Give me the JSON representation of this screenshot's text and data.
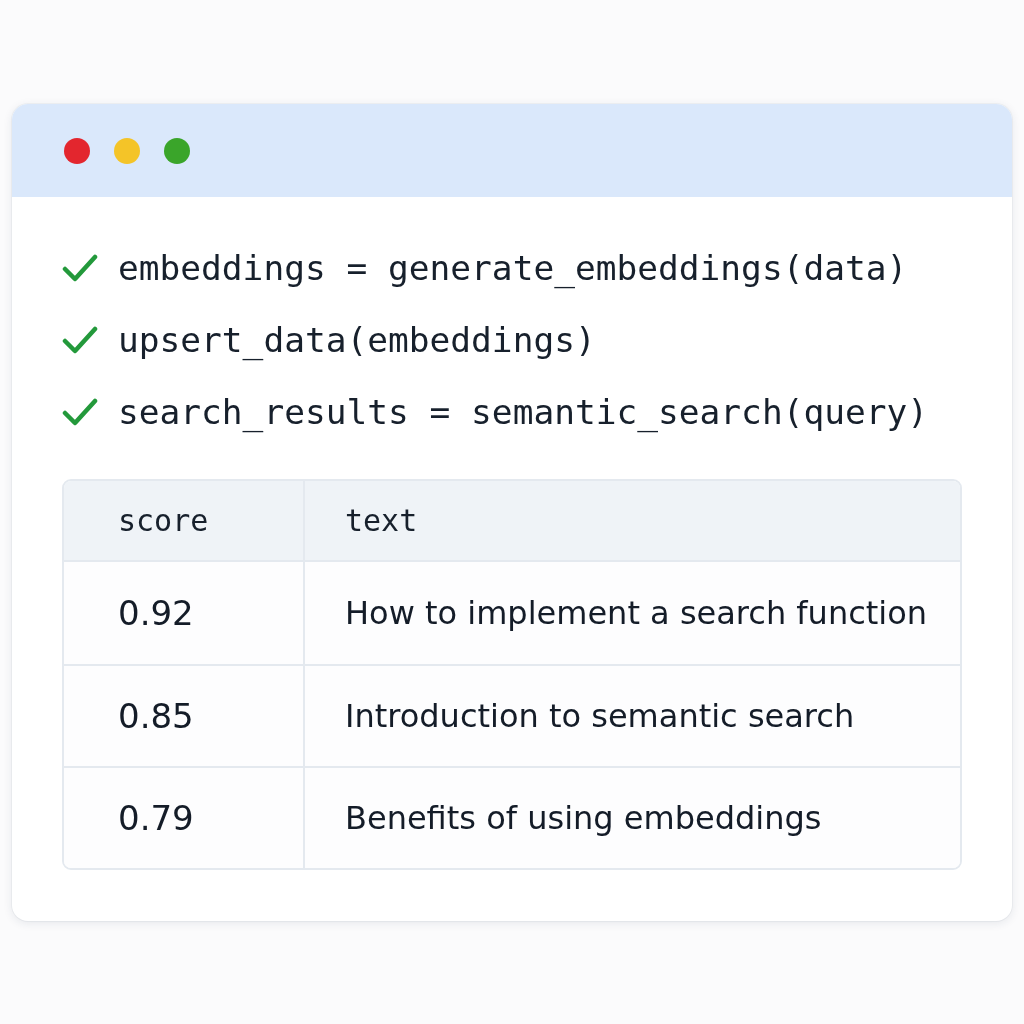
{
  "window": {
    "controls": [
      {
        "color": "#e3262e"
      },
      {
        "color": "#f4c428"
      },
      {
        "color": "#3aa52a"
      }
    ]
  },
  "steps": [
    {
      "code": "embeddings = generate_embeddings(data)",
      "done": true
    },
    {
      "code": "upsert_data(embeddings)",
      "done": true
    },
    {
      "code": "search_results = semantic_search(query)",
      "done": true
    }
  ],
  "results_table": {
    "columns": [
      "score",
      "text"
    ],
    "rows": [
      [
        "0.92",
        "How to implement a search function"
      ],
      [
        "0.85",
        "Introduction to semantic search"
      ],
      [
        "0.79",
        "Benefits of using embeddings"
      ]
    ]
  }
}
